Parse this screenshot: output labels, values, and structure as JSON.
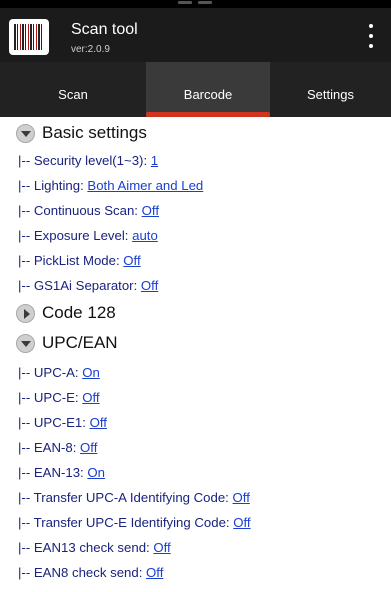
{
  "app": {
    "title": "Scan tool",
    "version": "ver:2.0.9"
  },
  "tabs": [
    {
      "label": "Scan",
      "active": false
    },
    {
      "label": "Barcode",
      "active": true
    },
    {
      "label": "Settings",
      "active": false
    }
  ],
  "colors": {
    "accent": "#d0341e",
    "link": "#1a3fd0",
    "header_bg": "#1b1b1b",
    "tab_bg": "#222222"
  },
  "sections": {
    "basic": {
      "title": "Basic settings",
      "expanded": true,
      "rows": [
        {
          "label": "|-- Security level(1~3): ",
          "value": "1"
        },
        {
          "label": "|-- Lighting: ",
          "value": "Both Aimer and Led"
        },
        {
          "label": "|-- Continuous Scan: ",
          "value": "Off"
        },
        {
          "label": "|-- Exposure Level: ",
          "value": "auto"
        },
        {
          "label": "|-- PickList Mode: ",
          "value": "Off"
        },
        {
          "label": "|-- GS1Ai Separator: ",
          "value": "Off"
        }
      ]
    },
    "code128": {
      "title": "Code 128",
      "expanded": false
    },
    "upcean": {
      "title": "UPC/EAN",
      "expanded": true,
      "rows": [
        {
          "label": "|-- UPC-A: ",
          "value": "On"
        },
        {
          "label": "|-- UPC-E: ",
          "value": "Off"
        },
        {
          "label": "|-- UPC-E1: ",
          "value": "Off"
        },
        {
          "label": "|-- EAN-8: ",
          "value": "Off"
        },
        {
          "label": "|-- EAN-13: ",
          "value": "On"
        },
        {
          "label": "|-- Transfer UPC-A Identifying Code: ",
          "value": "Off"
        },
        {
          "label": "|-- Transfer UPC-E Identifying Code: ",
          "value": "Off"
        },
        {
          "label": "|-- EAN13 check send: ",
          "value": "Off"
        },
        {
          "label": "|-- EAN8 check send: ",
          "value": "Off"
        }
      ]
    }
  }
}
